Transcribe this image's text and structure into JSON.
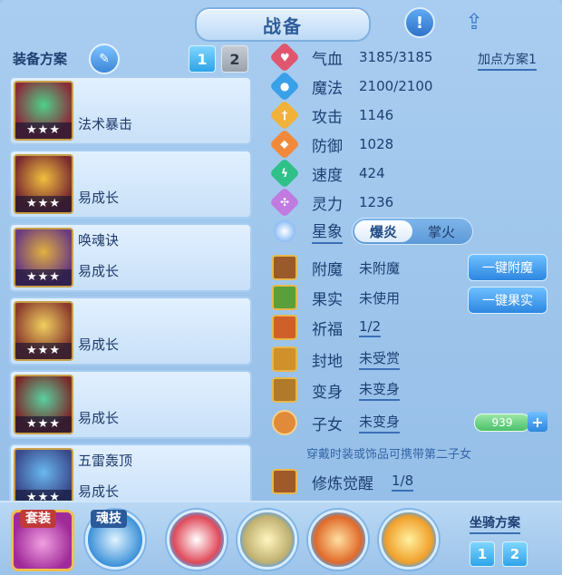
{
  "header": {
    "title": "战备",
    "help_icon": "exclamation-icon",
    "share_icon": "share-icon"
  },
  "equipment": {
    "label": "装备方案",
    "plan_buttons": [
      "1",
      "2"
    ],
    "active_plan": "1",
    "items": [
      {
        "name": "",
        "desc": "法术暴击",
        "stars": "★★★",
        "color": "#8a2b3a"
      },
      {
        "name": "",
        "desc": "易成长",
        "stars": "★★★",
        "color": "#7a2a2e"
      },
      {
        "name": "唤魂诀",
        "desc": "易成长",
        "stars": "★★★",
        "color": "#6b3a80"
      },
      {
        "name": "",
        "desc": "易成长",
        "stars": "★★★",
        "color": "#8a3a2c"
      },
      {
        "name": "",
        "desc": "易成长",
        "stars": "★★★",
        "color": "#7a2a2a"
      },
      {
        "name": "五雷轰顶",
        "desc": "易成长",
        "stars": "★★★",
        "color": "#3a4a8a"
      }
    ]
  },
  "stats": {
    "plan_link": "加点方案1",
    "rows": [
      {
        "label": "气血",
        "value": "3185/3185",
        "color": "#e0566e",
        "glyph": "♥"
      },
      {
        "label": "魔法",
        "value": "2100/2100",
        "color": "#3aa0e8",
        "glyph": "●"
      },
      {
        "label": "攻击",
        "value": "1146",
        "color": "#f0b23a",
        "glyph": "†"
      },
      {
        "label": "防御",
        "value": "1028",
        "color": "#f08a3a",
        "glyph": "◆"
      },
      {
        "label": "速度",
        "value": "424",
        "color": "#2fc08a",
        "glyph": "ϟ"
      },
      {
        "label": "灵力",
        "value": "1236",
        "color": "#c07ae0",
        "glyph": "✣"
      }
    ],
    "star": {
      "label": "星象",
      "options": [
        "爆炎",
        "掌火"
      ],
      "selected": "爆炎"
    }
  },
  "extras": {
    "rows": [
      {
        "label": "附魔",
        "value": "未附魔",
        "color": "#9a5a2a"
      },
      {
        "label": "果实",
        "value": "未使用",
        "color": "#5aa03a"
      },
      {
        "label": "祈福",
        "value": "1/2",
        "color": "#d0602a"
      },
      {
        "label": "封地",
        "value": "未受赏",
        "color": "#d0902a"
      },
      {
        "label": "变身",
        "value": "未变身",
        "color": "#b07a2a"
      }
    ],
    "enchant_button": "一键附魔",
    "fruit_button": "一键果实",
    "child": {
      "label": "子女",
      "value": "未变身",
      "bar_value": "939",
      "plus": "+",
      "color": "#e08a3a"
    },
    "hint": "穿戴时装或饰品可携带第二子女",
    "awaken": {
      "label": "修炼觉醒",
      "value": "1/8",
      "color": "#a05a2a"
    }
  },
  "bottom": {
    "suit_tag": "套装",
    "soul_tag": "魂技",
    "mount_label": "坐骑方案",
    "mount_buttons": [
      "1",
      "2"
    ],
    "skills": [
      {
        "name": "fan-blade-skill-icon",
        "color": "#e04a5a"
      },
      {
        "name": "monk-skill-icon",
        "color": "#c0b070"
      },
      {
        "name": "fire-strike-skill-icon",
        "color": "#e06a2a"
      },
      {
        "name": "flame-orb-skill-icon",
        "color": "#f0a02a"
      }
    ]
  }
}
